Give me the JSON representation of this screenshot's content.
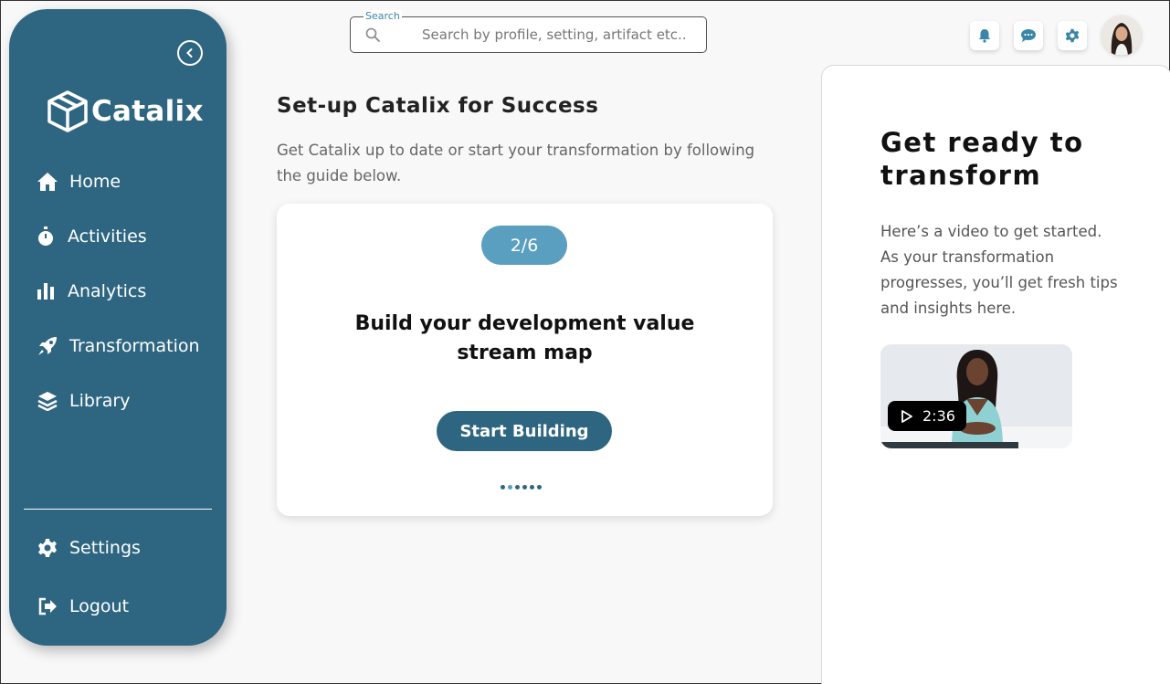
{
  "app": {
    "name": "Catalix"
  },
  "sidebar": {
    "items": [
      {
        "label": "Home",
        "icon": "home-icon"
      },
      {
        "label": "Activities",
        "icon": "stopwatch-icon"
      },
      {
        "label": "Analytics",
        "icon": "bar-chart-icon"
      },
      {
        "label": "Transformation",
        "icon": "rocket-icon"
      },
      {
        "label": "Library",
        "icon": "layers-icon"
      }
    ],
    "bottom_items": [
      {
        "label": "Settings",
        "icon": "gear-icon"
      },
      {
        "label": "Logout",
        "icon": "logout-icon"
      }
    ]
  },
  "search": {
    "label": "Search",
    "placeholder": "Search by profile, setting, artifact etc.."
  },
  "header": {
    "icons": [
      "bell-icon",
      "chat-icon",
      "gear-icon"
    ],
    "avatar": "user-avatar"
  },
  "main": {
    "title": "Set-up Catalix for Success",
    "subtitle": "Get Catalix up to date or start your transformation by following the guide below.",
    "card": {
      "step": "2/6",
      "step_current": 2,
      "step_total": 6,
      "title": "Build your development value stream map",
      "button_label": "Start Building"
    }
  },
  "right_panel": {
    "title": "Get ready to transform",
    "text": "Here’s a video to get started. As your transformation progresses, you’ll get fresh tips and insights here.",
    "video": {
      "duration": "2:36",
      "progress_fraction": 0.72
    }
  },
  "colors": {
    "primary": "#2e6681",
    "accent": "#5a9ec0",
    "background": "#f8f8f8"
  }
}
